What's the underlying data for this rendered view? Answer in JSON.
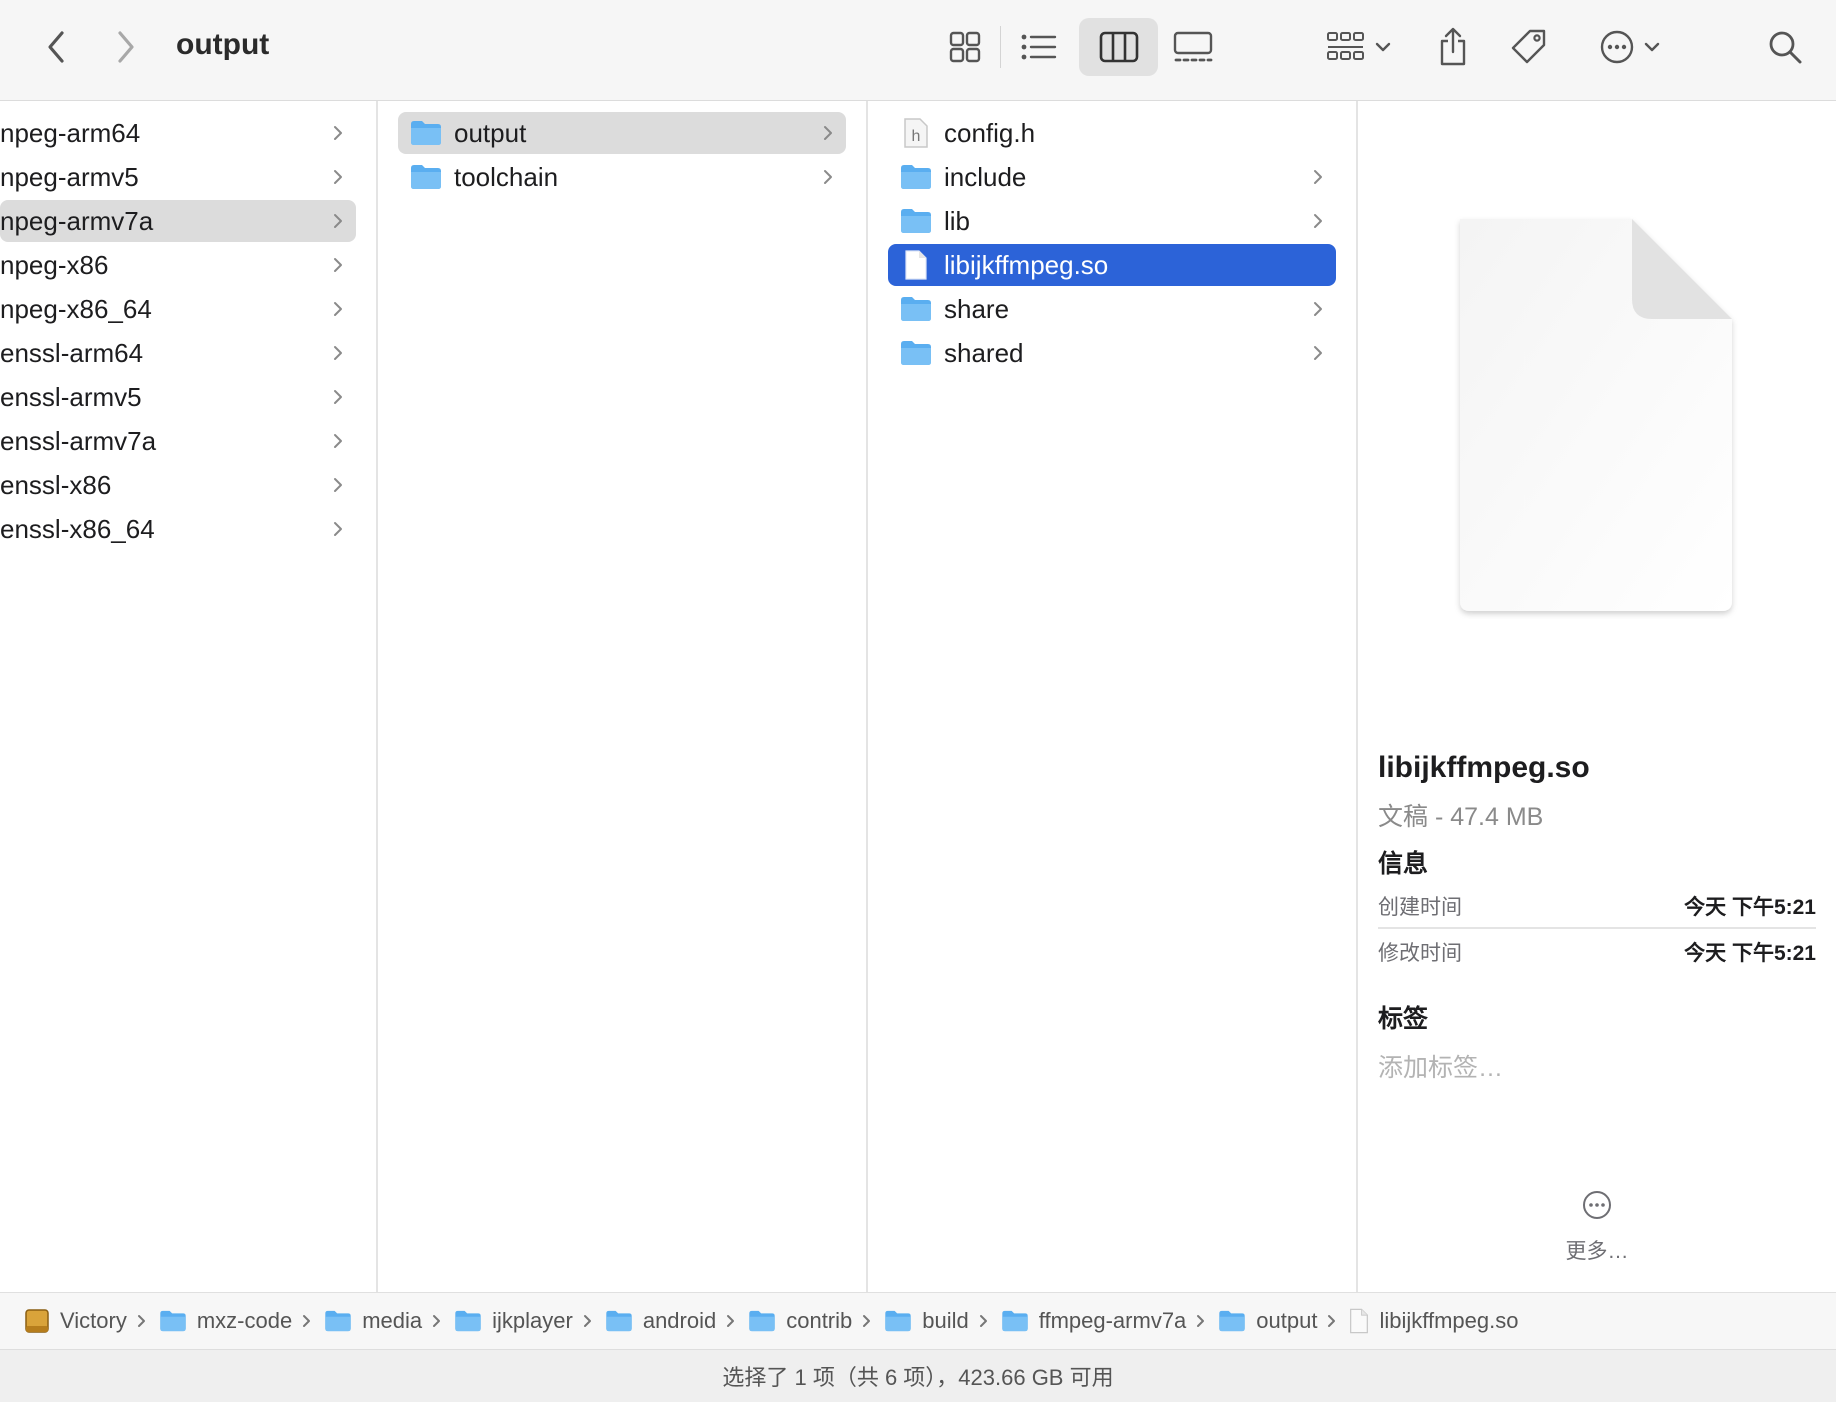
{
  "toolbar": {
    "title": "output",
    "back_icon": "chevron-left-icon",
    "forward_icon": "chevron-right-icon",
    "view_icons": [
      "icon-view-icon",
      "list-view-icon",
      "column-view-icon",
      "gallery-view-icon"
    ],
    "active_view": "column-view-icon",
    "group_icon": "group-by-icon",
    "share_icon": "share-icon",
    "tag_icon": "tag-icon",
    "more_icon": "ellipsis-circle-icon",
    "search_icon": "search-icon"
  },
  "column1": {
    "items": [
      {
        "label": "npeg-arm64",
        "has_children": true,
        "selected": false
      },
      {
        "label": "npeg-armv5",
        "has_children": true,
        "selected": false
      },
      {
        "label": "npeg-armv7a",
        "has_children": true,
        "selected": true
      },
      {
        "label": "npeg-x86",
        "has_children": true,
        "selected": false
      },
      {
        "label": "npeg-x86_64",
        "has_children": true,
        "selected": false
      },
      {
        "label": "enssl-arm64",
        "has_children": true,
        "selected": false
      },
      {
        "label": "enssl-armv5",
        "has_children": true,
        "selected": false
      },
      {
        "label": "enssl-armv7a",
        "has_children": true,
        "selected": false
      },
      {
        "label": "enssl-x86",
        "has_children": true,
        "selected": false
      },
      {
        "label": "enssl-x86_64",
        "has_children": true,
        "selected": false
      }
    ]
  },
  "column2": {
    "items": [
      {
        "label": "output",
        "icon": "folder-icon",
        "has_children": true,
        "selected": true
      },
      {
        "label": "toolchain",
        "icon": "folder-icon",
        "has_children": true,
        "selected": false
      }
    ]
  },
  "column3": {
    "items": [
      {
        "label": "config.h",
        "icon": "header-file-icon",
        "has_children": false,
        "selected": false
      },
      {
        "label": "include",
        "icon": "folder-icon",
        "has_children": true,
        "selected": false
      },
      {
        "label": "lib",
        "icon": "folder-icon",
        "has_children": true,
        "selected": false
      },
      {
        "label": "libijkffmpeg.so",
        "icon": "document-icon",
        "has_children": false,
        "selected": true
      },
      {
        "label": "share",
        "icon": "folder-icon",
        "has_children": true,
        "selected": false
      },
      {
        "label": "shared",
        "icon": "folder-icon",
        "has_children": true,
        "selected": false
      }
    ]
  },
  "preview": {
    "file_name": "libijkffmpeg.so",
    "kind_size": "文稿 - 47.4 MB",
    "info_heading": "信息",
    "created_label": "创建时间",
    "created_value": "今天 下午5:21",
    "modified_label": "修改时间",
    "modified_value": "今天 下午5:21",
    "tags_heading": "标签",
    "tags_placeholder": "添加标签…",
    "more_label": "更多…"
  },
  "pathbar": {
    "crumbs": [
      {
        "label": "Victory",
        "icon": "drive-icon"
      },
      {
        "label": "mxz-code",
        "icon": "folder-icon"
      },
      {
        "label": "media",
        "icon": "folder-icon"
      },
      {
        "label": "ijkplayer",
        "icon": "folder-icon"
      },
      {
        "label": "android",
        "icon": "folder-icon"
      },
      {
        "label": "contrib",
        "icon": "folder-icon"
      },
      {
        "label": "build",
        "icon": "folder-icon"
      },
      {
        "label": "ffmpeg-armv7a",
        "icon": "folder-icon"
      },
      {
        "label": "output",
        "icon": "folder-icon"
      },
      {
        "label": "libijkffmpeg.so",
        "icon": "document-icon"
      }
    ]
  },
  "status": {
    "text": "选择了 1 项（共 6 项），423.66 GB 可用"
  },
  "colors": {
    "selection_blue": "#2c63d8",
    "selection_gray": "#dcdcdc",
    "folder_blue": "#5aaef0"
  }
}
